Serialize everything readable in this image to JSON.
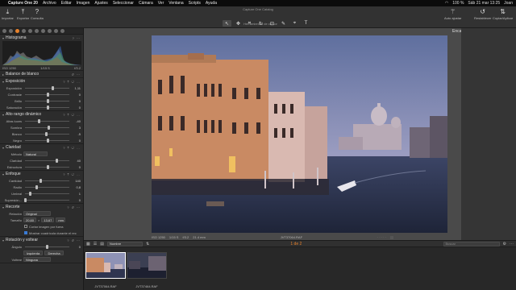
{
  "menubar": {
    "app": "Capture One 20",
    "items": [
      "Archivo",
      "Editar",
      "Imagen",
      "Ajustes",
      "Seleccionar",
      "Cámara",
      "Ver",
      "Ventana",
      "Scripts",
      "Ayuda"
    ],
    "battery": "100 %",
    "datetime": "Sáb 21 mar  13:25",
    "user": "Joan"
  },
  "toolbar": {
    "window_title": "Capture One Catalog",
    "import": "Importar",
    "export": "Exportar",
    "consult": "Consulta",
    "cursor_tools_label": "Herramientas de cursor",
    "auto_adjust": "Auto ajustar",
    "reset": "Restablecer",
    "copy_apply": "Copiar/Aplicar",
    "fit": "Encajar"
  },
  "left": {
    "histogram": {
      "title": "Histograma",
      "iso": "ISO 1250",
      "shutter": "1/15 S",
      "fstop": "f/3.2"
    },
    "white_balance": {
      "title": "Balance de blanco"
    },
    "exposure": {
      "title": "Exposición",
      "rows": [
        {
          "label": "Exposición",
          "value": "1,11",
          "level": 0.62
        },
        {
          "label": "Contraste",
          "value": "0",
          "level": 0.5
        },
        {
          "label": "Brillo",
          "value": "0",
          "level": 0.5
        },
        {
          "label": "Saturación",
          "value": "0",
          "level": 0.5
        }
      ]
    },
    "hdr": {
      "title": "Alto rango dinámico",
      "rows": [
        {
          "label": "Altas luces",
          "value": "-40",
          "level": 0.3
        },
        {
          "label": "Sombra",
          "value": "3",
          "level": 0.52
        },
        {
          "label": "Blanco",
          "value": "-5",
          "level": 0.47
        },
        {
          "label": "Negro",
          "value": "0",
          "level": 0.5
        }
      ]
    },
    "clarity": {
      "title": "Claridad",
      "method_label": "Método",
      "method": "Natural",
      "rows": [
        {
          "label": "Claridad",
          "value": "40",
          "level": 0.7
        },
        {
          "label": "Estructura",
          "value": "0",
          "level": 0.5
        }
      ]
    },
    "sharpening": {
      "title": "Enfoque",
      "rows": [
        {
          "label": "Cantidad",
          "value": "140",
          "level": 0.35
        },
        {
          "label": "Radio",
          "value": "0,8",
          "level": 0.25
        },
        {
          "label": "Umbral",
          "value": "1",
          "level": 0.1
        },
        {
          "label": "Supresión...",
          "value": "0",
          "level": 0.0
        }
      ]
    },
    "crop": {
      "title": "Recorte",
      "ratio_label": "Relación",
      "ratio": "Original",
      "size_label": "Tamaño",
      "width": "20,60",
      "height": "13,67",
      "unit": "mm",
      "crop_outside": "Cortar imagen por fuera",
      "show_mask": "Mostrar cuadrícula durante el rec"
    },
    "rotation": {
      "title": "Rotación y voltear",
      "angle_label": "Ángulo",
      "left_btn": "Izquierda",
      "right_btn": "Derecha",
      "flip_label": "Voltear",
      "flip": "Ninguna"
    }
  },
  "main": {
    "iso": "ISO 1250",
    "shutter": "1/15 S",
    "fstop": "f/3.2",
    "focal": "21.4 mm",
    "filename": "JVT37064.RAF"
  },
  "browser": {
    "sort": "Nombre",
    "counter": "1 de 2",
    "search_placeholder": "Buscar"
  },
  "thumbs": [
    {
      "caption": "JVT37064.RAF"
    },
    {
      "caption": "JVT37464.RAF"
    }
  ],
  "colors": {
    "accent": "#e8822c",
    "panel": "#2c2c2c",
    "viewer": "#4a4a4a"
  }
}
